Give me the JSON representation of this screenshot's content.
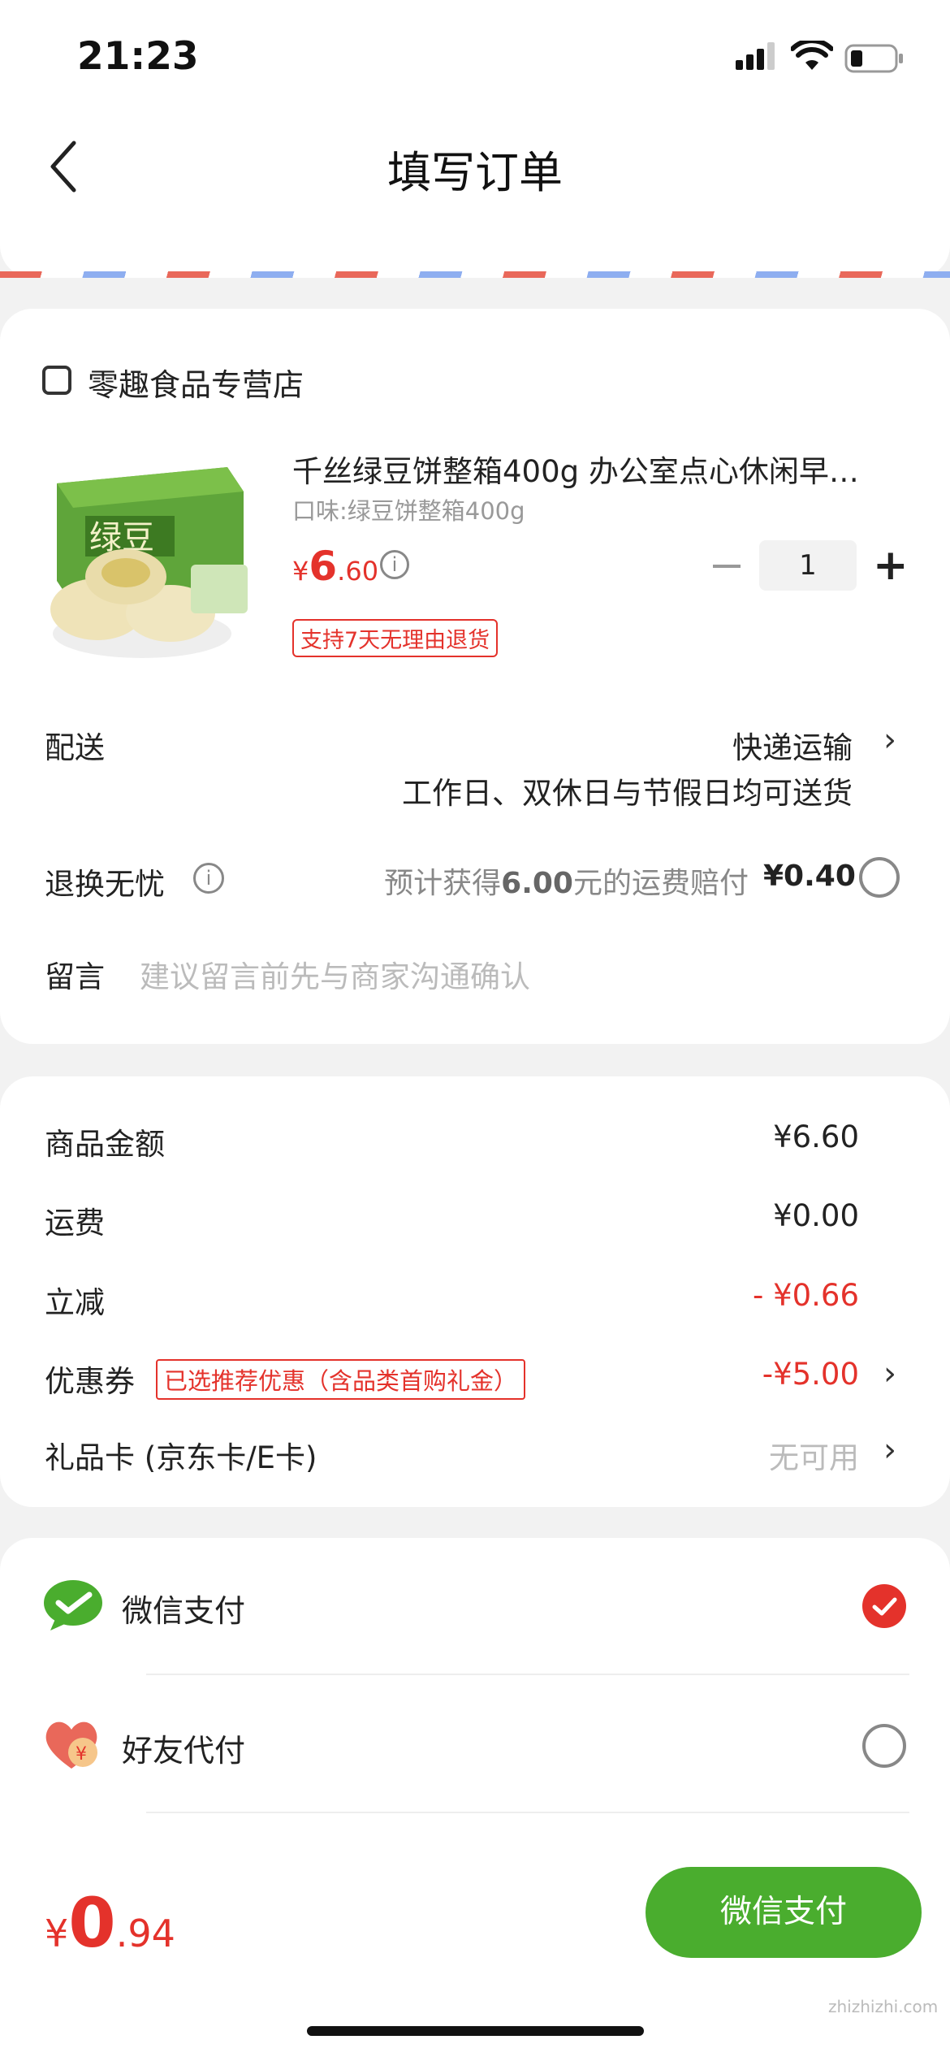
{
  "status_bar": {
    "time": "21:23"
  },
  "header": {
    "title": "填写订单"
  },
  "shop": {
    "name": "零趣食品专营店"
  },
  "product": {
    "title": "千丝绿豆饼整箱400g 办公室点心休闲早…",
    "spec": "口味:绿豆饼整箱400g",
    "price_symbol": "¥",
    "price_int": "6",
    "price_dec": ".60",
    "quantity": "1",
    "tag": "支持7天无理由退货"
  },
  "delivery": {
    "label": "配送",
    "method": "快递运输",
    "note": "工作日、双休日与节假日均可送货"
  },
  "return_insurance": {
    "label": "退换无忧",
    "desc_pre": "预计获得",
    "desc_amount": "6.00",
    "desc_post": "元的运费赔付",
    "price": "¥0.40",
    "checked": false
  },
  "message": {
    "label": "留言",
    "placeholder": "建议留言前先与商家沟通确认"
  },
  "summary": {
    "goods_label": "商品金额",
    "goods_value": "¥6.60",
    "shipping_label": "运费",
    "shipping_value": "¥0.00",
    "discount_label": "立减",
    "discount_value": "- ¥0.66",
    "coupon_label": "优惠券",
    "coupon_tag": "已选推荐优惠（含品类首购礼金）",
    "coupon_value": "-¥5.00",
    "giftcard_label": "礼品卡 (京东卡/E卡)",
    "giftcard_value": "无可用"
  },
  "payment": {
    "wechat_label": "微信支付",
    "wechat_selected": true,
    "friend_label": "好友代付",
    "friend_selected": false
  },
  "footer": {
    "total_symbol": "¥",
    "total_int": "0",
    "total_dec": ".94",
    "pay_button": "微信支付"
  },
  "watermark": "zhizhizhi.com",
  "colors": {
    "accent_red": "#e4322b",
    "wechat_green": "#4aad2e"
  }
}
